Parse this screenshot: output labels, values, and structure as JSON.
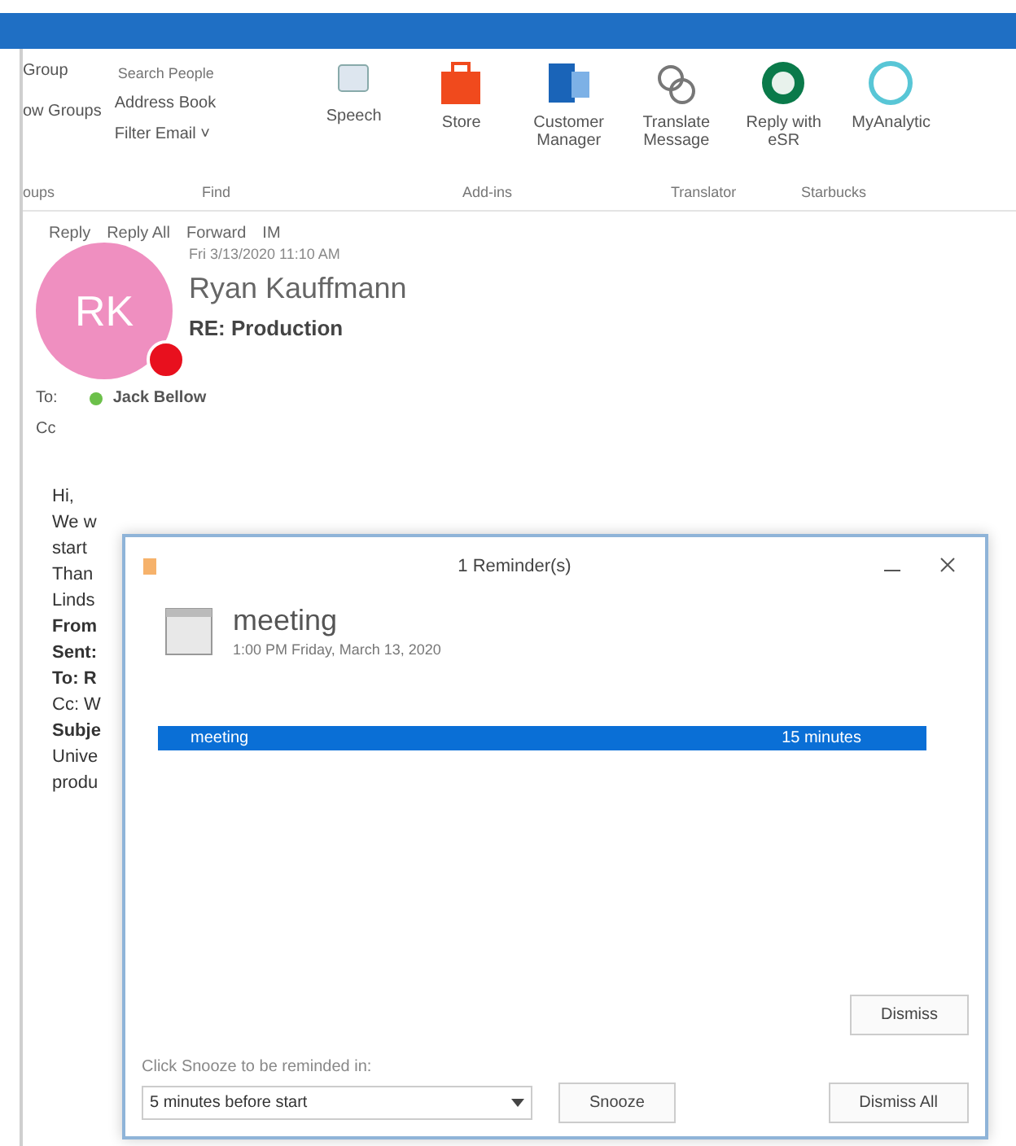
{
  "ribbon": {
    "groups_col": [
      "Group",
      "ow Groups"
    ],
    "search": {
      "placeholder": "Search People"
    },
    "find_items": [
      "Address Book",
      "Filter Email ˅"
    ],
    "buttons": [
      {
        "kind": "speech",
        "label": "Speech"
      },
      {
        "kind": "store",
        "label": "Store"
      },
      {
        "kind": "customer",
        "label": "Customer Manager"
      },
      {
        "kind": "translate",
        "label": "Translate Message"
      },
      {
        "kind": "starbucks",
        "label": "Reply with eSR"
      },
      {
        "kind": "analytics",
        "label": "MyAnalytic"
      }
    ],
    "group_labels": [
      "oups",
      "Find",
      "Add-ins",
      "Translator",
      "Starbucks"
    ]
  },
  "message": {
    "actions": [
      "Reply",
      "Reply All",
      "Forward",
      "IM"
    ],
    "date": "Fri 3/13/2020 11:10 AM",
    "avatar": "RK",
    "sender": "Ryan Kauffmann",
    "subject": "RE: Production",
    "to_label": "To:",
    "to": "Jack Bellow",
    "cc_label": "Cc"
  },
  "body": [
    {
      "text": "Hi,",
      "bold": false
    },
    {
      "text": "We w",
      "bold": false
    },
    {
      "text": "start",
      "bold": false
    },
    {
      "text": "Than",
      "bold": false
    },
    {
      "text": "Linds",
      "bold": false
    },
    {
      "text": "From",
      "bold": true
    },
    {
      "text": "Sent:",
      "bold": true
    },
    {
      "text": "To: R",
      "bold": true
    },
    {
      "text": "Cc: W",
      "bold": false
    },
    {
      "text": "Subje",
      "bold": true
    },
    {
      "text": "Unive",
      "bold": false
    },
    {
      "text": "produ",
      "bold": false
    }
  ],
  "reminder": {
    "title": "1 Reminder(s)",
    "subject": "meeting",
    "when": "1:00 PM Friday, March 13, 2020",
    "items": [
      {
        "subject": "meeting",
        "due": "15 minutes",
        "selected": true
      }
    ],
    "dismiss": "Dismiss",
    "snooze_label": "Click Snooze to be reminded in:",
    "snooze_value": "5 minutes before start",
    "snooze": "Snooze",
    "dismiss_all": "Dismiss All"
  }
}
